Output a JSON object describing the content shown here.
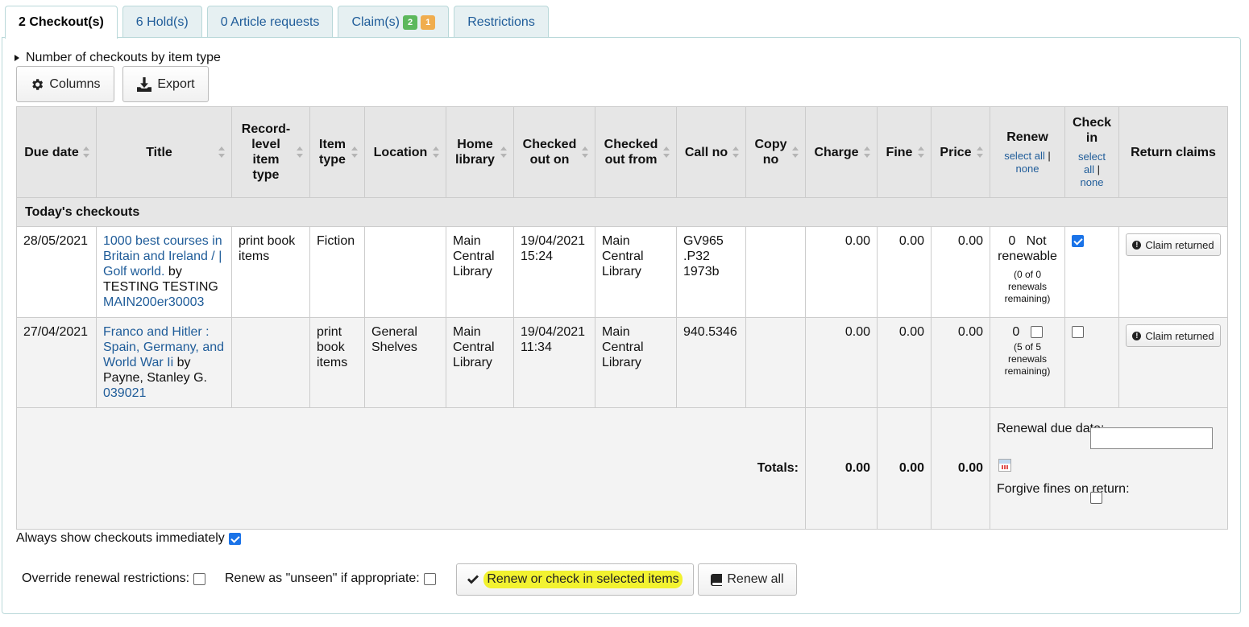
{
  "tabs": [
    {
      "label": "2 Checkout(s)"
    },
    {
      "label": "6 Hold(s)"
    },
    {
      "label": "0 Article requests"
    },
    {
      "label": "Claim(s)",
      "badge_green": "2",
      "badge_orange": "1"
    },
    {
      "label": "Restrictions"
    }
  ],
  "summary_toggle": "Number of checkouts by item type",
  "toolbar": {
    "columns_label": "Columns",
    "export_label": "Export"
  },
  "table": {
    "headers": {
      "due_date": "Due date",
      "title": "Title",
      "record_level_item_type": "Record-level item type",
      "item_type": "Item type",
      "location": "Location",
      "home_library": "Home library",
      "checked_out_on": "Checked out on",
      "checked_out_from": "Checked out from",
      "call_no": "Call no",
      "copy_no": "Copy no",
      "charge": "Charge",
      "fine": "Fine",
      "price": "Price",
      "renew": "Renew",
      "renew_select_all": "select all",
      "renew_none": "none",
      "check_in": "Check in",
      "checkin_select": "select",
      "checkin_all": "all",
      "checkin_none": "none",
      "return_claims": "Return claims"
    },
    "group_label": "Today's checkouts",
    "rows": [
      {
        "due_date": "28/05/2021",
        "title": "1000 best courses in Britain and Ireland / | Golf world.",
        "by": "by",
        "author": "TESTING TESTING",
        "barcode": "MAIN200er30003",
        "record_level_item_type": "print book items",
        "item_type": "Fiction",
        "location": "",
        "home_library": "Main Central Library",
        "checked_out_on": "19/04/2021 15:24",
        "checked_out_from": "Main Central Library",
        "call_no": "GV965 .P32 1973b",
        "copy_no": "",
        "charge": "0.00",
        "fine": "0.00",
        "price": "0.00",
        "renew_count": "0",
        "renew_status": "Not renewable",
        "renewals_remaining": "(0 of 0 renewals remaining)",
        "checkin_checked": true,
        "claim_label": "Claim returned"
      },
      {
        "due_date": "27/04/2021",
        "title": "Franco and Hitler : Spain, Germany, and World War Ii",
        "by": "by",
        "author": "Payne, Stanley G.",
        "barcode": "039021",
        "record_level_item_type": "",
        "item_type": "print book items",
        "location": "General Shelves",
        "home_library": "Main Central Library",
        "checked_out_on": "19/04/2021 11:34",
        "checked_out_from": "Main Central Library",
        "call_no": "940.5346",
        "copy_no": "",
        "charge": "0.00",
        "fine": "0.00",
        "price": "0.00",
        "renew_count": "0",
        "renew_status": "",
        "renewals_remaining": "(5 of 5 renewals remaining)",
        "checkin_checked": false,
        "claim_label": "Claim returned"
      }
    ],
    "totals": {
      "label": "Totals:",
      "charge": "0.00",
      "fine": "0.00",
      "price": "0.00",
      "renewal_due_date_label": "Renewal due date:",
      "renewal_due_date_value": "",
      "forgive_fines_label": "Forgive fines on return:"
    }
  },
  "options": {
    "always_show": "Always show checkouts immediately",
    "override_renewal": "Override renewal restrictions:",
    "renew_unseen": "Renew as \"unseen\" if appropriate:"
  },
  "actions": {
    "renew_selected": "Renew or check in selected items",
    "renew_all": "Renew all"
  },
  "colors": {
    "link": "#1f5c99",
    "highlight": "#f2f230",
    "checkbox_checked": "#1a73e8"
  }
}
